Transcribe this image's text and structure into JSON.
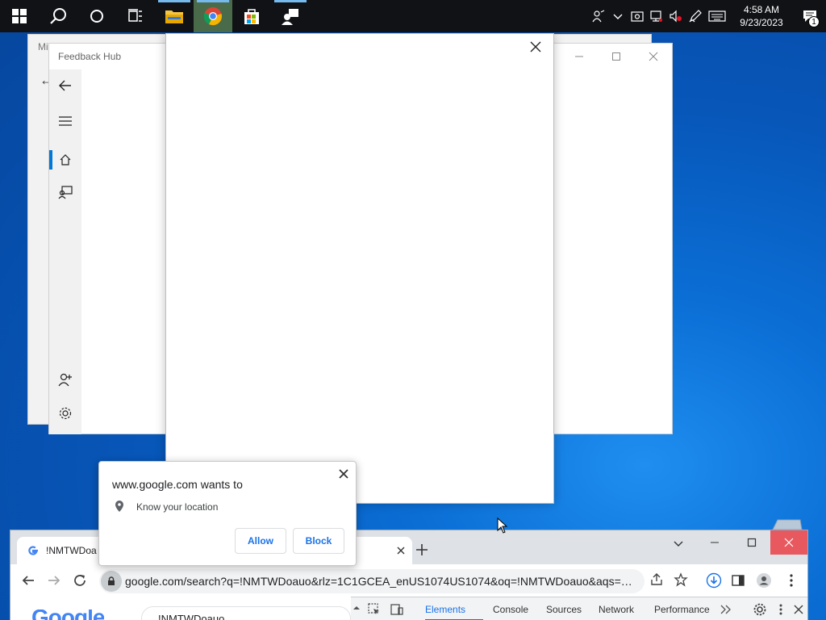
{
  "taskbar": {
    "apps": [
      "start",
      "search",
      "cortana",
      "task-view",
      "file-explorer",
      "chrome",
      "microsoft-store",
      "feedback-hub"
    ],
    "clock": {
      "time": "4:58 AM",
      "date": "9/23/2023"
    },
    "notification_count": "1"
  },
  "back_window": {
    "title": "Mi"
  },
  "feedback_hub": {
    "title": "Feedback Hub"
  },
  "permission_popup": {
    "title": "www.google.com wants to",
    "permission": "Know your location",
    "allow_label": "Allow",
    "block_label": "Block"
  },
  "chrome": {
    "tab_title": "!NMTWDoa",
    "url": "google.com/search?q=!NMTWDoauo&rlz=1C1GCEA_enUS1074US1074&oq=!NMTWDoauo&aqs=ch...",
    "search_query": "!NMTWDoauo",
    "logo": "Google",
    "devtools_tabs": [
      "Elements",
      "Console",
      "Sources",
      "Network",
      "Performance"
    ]
  },
  "colors": {
    "accent": "#0078d7",
    "chrome_link": "#1a73e8",
    "close_red": "#e8585f"
  }
}
